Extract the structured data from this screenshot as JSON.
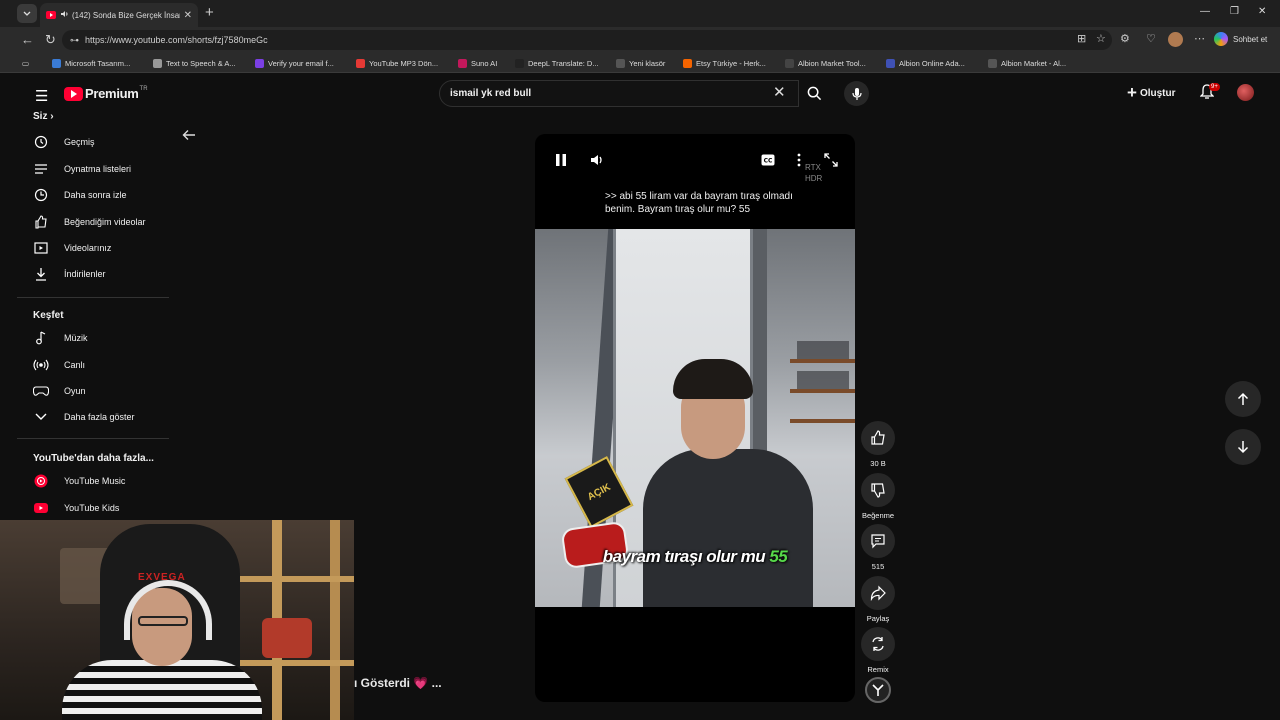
{
  "browser": {
    "tab_title": "(142) Sonda Bize Gerçek İnsan",
    "url": "https://www.youtube.com/shorts/fzj7580meGc",
    "copilot_label": "Sohbet et",
    "bookmarks": [
      {
        "label": "Microsoft Tasarım...",
        "color": "#3a7bd5"
      },
      {
        "label": "Text to Speech & A...",
        "color": "#999999"
      },
      {
        "label": "Verify your email f...",
        "color": "#7b3fe4"
      },
      {
        "label": "YouTube MP3 Dön...",
        "color": "#e53935"
      },
      {
        "label": "Suno AI",
        "color": "#c2185b"
      },
      {
        "label": "DeepL Translate: D...",
        "color": "#222222"
      },
      {
        "label": "Yeni klasör",
        "color": "#555555"
      },
      {
        "label": "Etsy Türkiye - Herk...",
        "color": "#f56400"
      },
      {
        "label": "Albion Market Tool...",
        "color": "#444444"
      },
      {
        "label": "Albion Online Ada...",
        "color": "#3f51b5"
      },
      {
        "label": "Albion Market - Al...",
        "color": "#555555"
      }
    ]
  },
  "youtube": {
    "brand": "Premium",
    "country_code": "TR",
    "search_value": "ismail yk red bull",
    "create_label": "Oluştur",
    "notification_badge": "9+",
    "sidebar": {
      "you_heading": "Siz",
      "you_items": [
        {
          "label": "Geçmiş",
          "icon": "history-icon"
        },
        {
          "label": "Oynatma listeleri",
          "icon": "playlists-icon"
        },
        {
          "label": "Daha sonra izle",
          "icon": "watch-later-icon"
        },
        {
          "label": "Beğendiğim videolar",
          "icon": "liked-videos-icon"
        },
        {
          "label": "Videolarınız",
          "icon": "your-videos-icon"
        },
        {
          "label": "İndirilenler",
          "icon": "downloads-icon"
        }
      ],
      "explore_heading": "Keşfet",
      "explore_items": [
        {
          "label": "Müzik",
          "icon": "music-icon"
        },
        {
          "label": "Canlı",
          "icon": "live-icon"
        },
        {
          "label": "Oyun",
          "icon": "gaming-icon"
        },
        {
          "label": "Daha fazla göster",
          "icon": "chevron-down-icon"
        }
      ],
      "more_heading": "YouTube'dan daha fazla...",
      "more_items": [
        {
          "label": "YouTube Music",
          "icon": "youtube-music-icon"
        },
        {
          "label": "YouTube Kids",
          "icon": "youtube-kids-icon"
        }
      ]
    },
    "player": {
      "hdr_label_1": "RTX",
      "hdr_label_2": "HDR",
      "caption_text": ">> abi 55 liram var da bayram tıraş olmadı benim. Bayram tıraş olur mu? 55",
      "subtitle_text": "bayram tıraşı olur mu",
      "subtitle_number": "55",
      "sticker_text": "AÇIK"
    },
    "actions": {
      "like_count": "30 B",
      "dislike_label": "Beğenme",
      "comment_count": "515",
      "share_label": "Paylaş",
      "remix_label": "Remix"
    },
    "title_behind": "ı Gösterdi 💗 ..."
  },
  "webcam": {
    "chair_brand": "EXVEGA"
  }
}
